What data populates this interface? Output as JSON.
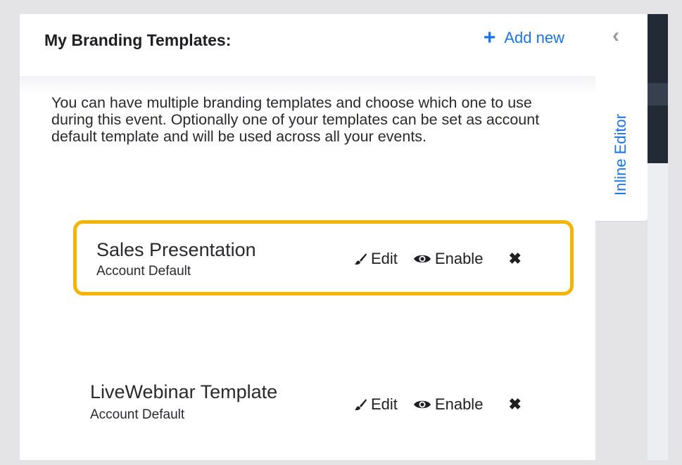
{
  "header": {
    "title": "My Branding Templates:",
    "add_new_label": "Add new",
    "add_icon": "plus-icon"
  },
  "description": "You can have multiple branding templates and choose which one to use during this event. Optionally one of your templates can be set as account default template and will be used across all your events.",
  "templates": [
    {
      "name": "Sales Presentation",
      "subtitle": "Account Default",
      "edit_label": "Edit",
      "enable_label": "Enable",
      "highlighted": true
    },
    {
      "name": "LiveWebinar Template",
      "subtitle": "Account Default",
      "edit_label": "Edit",
      "enable_label": "Enable",
      "highlighted": false
    }
  ],
  "side_tab": {
    "label": "Inline Editor",
    "collapse_icon": "chevron-left-icon"
  },
  "colors": {
    "accent": "#1a73e8",
    "highlight_border": "#f4b400",
    "text": "#2a2a2e"
  }
}
